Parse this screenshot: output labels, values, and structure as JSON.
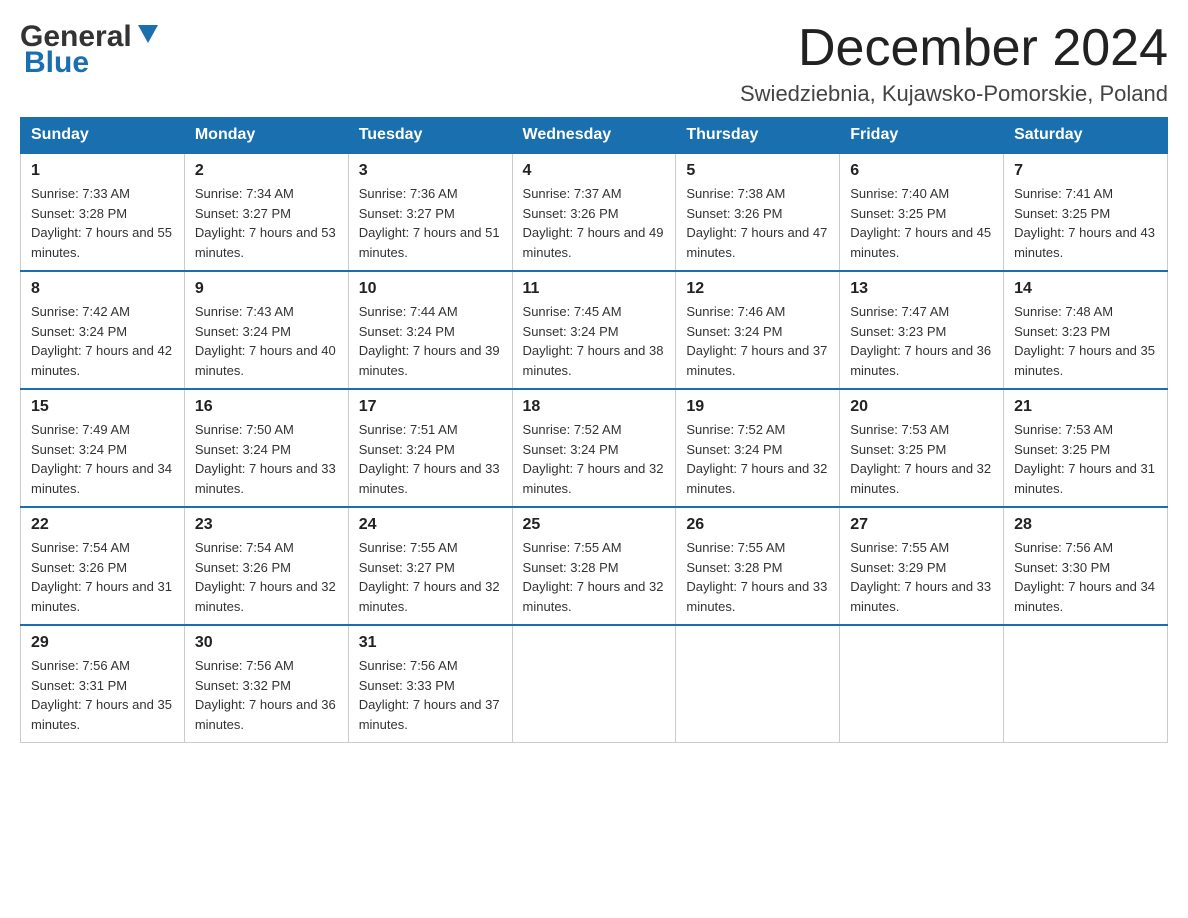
{
  "header": {
    "logo_general": "General",
    "logo_blue": "Blue",
    "month_title": "December 2024",
    "location": "Swiedziebnia, Kujawsko-Pomorskie, Poland"
  },
  "weekdays": [
    "Sunday",
    "Monday",
    "Tuesday",
    "Wednesday",
    "Thursday",
    "Friday",
    "Saturday"
  ],
  "weeks": [
    [
      {
        "day": "1",
        "sunrise": "Sunrise: 7:33 AM",
        "sunset": "Sunset: 3:28 PM",
        "daylight": "Daylight: 7 hours and 55 minutes."
      },
      {
        "day": "2",
        "sunrise": "Sunrise: 7:34 AM",
        "sunset": "Sunset: 3:27 PM",
        "daylight": "Daylight: 7 hours and 53 minutes."
      },
      {
        "day": "3",
        "sunrise": "Sunrise: 7:36 AM",
        "sunset": "Sunset: 3:27 PM",
        "daylight": "Daylight: 7 hours and 51 minutes."
      },
      {
        "day": "4",
        "sunrise": "Sunrise: 7:37 AM",
        "sunset": "Sunset: 3:26 PM",
        "daylight": "Daylight: 7 hours and 49 minutes."
      },
      {
        "day": "5",
        "sunrise": "Sunrise: 7:38 AM",
        "sunset": "Sunset: 3:26 PM",
        "daylight": "Daylight: 7 hours and 47 minutes."
      },
      {
        "day": "6",
        "sunrise": "Sunrise: 7:40 AM",
        "sunset": "Sunset: 3:25 PM",
        "daylight": "Daylight: 7 hours and 45 minutes."
      },
      {
        "day": "7",
        "sunrise": "Sunrise: 7:41 AM",
        "sunset": "Sunset: 3:25 PM",
        "daylight": "Daylight: 7 hours and 43 minutes."
      }
    ],
    [
      {
        "day": "8",
        "sunrise": "Sunrise: 7:42 AM",
        "sunset": "Sunset: 3:24 PM",
        "daylight": "Daylight: 7 hours and 42 minutes."
      },
      {
        "day": "9",
        "sunrise": "Sunrise: 7:43 AM",
        "sunset": "Sunset: 3:24 PM",
        "daylight": "Daylight: 7 hours and 40 minutes."
      },
      {
        "day": "10",
        "sunrise": "Sunrise: 7:44 AM",
        "sunset": "Sunset: 3:24 PM",
        "daylight": "Daylight: 7 hours and 39 minutes."
      },
      {
        "day": "11",
        "sunrise": "Sunrise: 7:45 AM",
        "sunset": "Sunset: 3:24 PM",
        "daylight": "Daylight: 7 hours and 38 minutes."
      },
      {
        "day": "12",
        "sunrise": "Sunrise: 7:46 AM",
        "sunset": "Sunset: 3:24 PM",
        "daylight": "Daylight: 7 hours and 37 minutes."
      },
      {
        "day": "13",
        "sunrise": "Sunrise: 7:47 AM",
        "sunset": "Sunset: 3:23 PM",
        "daylight": "Daylight: 7 hours and 36 minutes."
      },
      {
        "day": "14",
        "sunrise": "Sunrise: 7:48 AM",
        "sunset": "Sunset: 3:23 PM",
        "daylight": "Daylight: 7 hours and 35 minutes."
      }
    ],
    [
      {
        "day": "15",
        "sunrise": "Sunrise: 7:49 AM",
        "sunset": "Sunset: 3:24 PM",
        "daylight": "Daylight: 7 hours and 34 minutes."
      },
      {
        "day": "16",
        "sunrise": "Sunrise: 7:50 AM",
        "sunset": "Sunset: 3:24 PM",
        "daylight": "Daylight: 7 hours and 33 minutes."
      },
      {
        "day": "17",
        "sunrise": "Sunrise: 7:51 AM",
        "sunset": "Sunset: 3:24 PM",
        "daylight": "Daylight: 7 hours and 33 minutes."
      },
      {
        "day": "18",
        "sunrise": "Sunrise: 7:52 AM",
        "sunset": "Sunset: 3:24 PM",
        "daylight": "Daylight: 7 hours and 32 minutes."
      },
      {
        "day": "19",
        "sunrise": "Sunrise: 7:52 AM",
        "sunset": "Sunset: 3:24 PM",
        "daylight": "Daylight: 7 hours and 32 minutes."
      },
      {
        "day": "20",
        "sunrise": "Sunrise: 7:53 AM",
        "sunset": "Sunset: 3:25 PM",
        "daylight": "Daylight: 7 hours and 32 minutes."
      },
      {
        "day": "21",
        "sunrise": "Sunrise: 7:53 AM",
        "sunset": "Sunset: 3:25 PM",
        "daylight": "Daylight: 7 hours and 31 minutes."
      }
    ],
    [
      {
        "day": "22",
        "sunrise": "Sunrise: 7:54 AM",
        "sunset": "Sunset: 3:26 PM",
        "daylight": "Daylight: 7 hours and 31 minutes."
      },
      {
        "day": "23",
        "sunrise": "Sunrise: 7:54 AM",
        "sunset": "Sunset: 3:26 PM",
        "daylight": "Daylight: 7 hours and 32 minutes."
      },
      {
        "day": "24",
        "sunrise": "Sunrise: 7:55 AM",
        "sunset": "Sunset: 3:27 PM",
        "daylight": "Daylight: 7 hours and 32 minutes."
      },
      {
        "day": "25",
        "sunrise": "Sunrise: 7:55 AM",
        "sunset": "Sunset: 3:28 PM",
        "daylight": "Daylight: 7 hours and 32 minutes."
      },
      {
        "day": "26",
        "sunrise": "Sunrise: 7:55 AM",
        "sunset": "Sunset: 3:28 PM",
        "daylight": "Daylight: 7 hours and 33 minutes."
      },
      {
        "day": "27",
        "sunrise": "Sunrise: 7:55 AM",
        "sunset": "Sunset: 3:29 PM",
        "daylight": "Daylight: 7 hours and 33 minutes."
      },
      {
        "day": "28",
        "sunrise": "Sunrise: 7:56 AM",
        "sunset": "Sunset: 3:30 PM",
        "daylight": "Daylight: 7 hours and 34 minutes."
      }
    ],
    [
      {
        "day": "29",
        "sunrise": "Sunrise: 7:56 AM",
        "sunset": "Sunset: 3:31 PM",
        "daylight": "Daylight: 7 hours and 35 minutes."
      },
      {
        "day": "30",
        "sunrise": "Sunrise: 7:56 AM",
        "sunset": "Sunset: 3:32 PM",
        "daylight": "Daylight: 7 hours and 36 minutes."
      },
      {
        "day": "31",
        "sunrise": "Sunrise: 7:56 AM",
        "sunset": "Sunset: 3:33 PM",
        "daylight": "Daylight: 7 hours and 37 minutes."
      },
      null,
      null,
      null,
      null
    ]
  ]
}
